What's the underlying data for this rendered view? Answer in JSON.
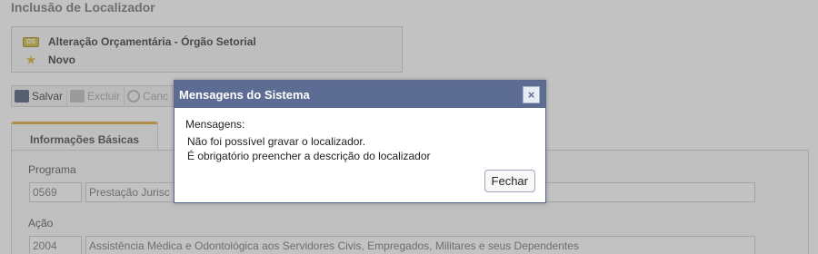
{
  "page": {
    "title": "Inclusão de Localizador"
  },
  "header_box": {
    "badge_label": "OS",
    "org_name": "Alteração Orçamentária - Órgão Setorial",
    "status": "Novo"
  },
  "toolbar": {
    "save_label": "Salvar",
    "delete_label": "Excluir",
    "cancel_label": "Canc"
  },
  "tabs": {
    "active_label": "Informações Básicas"
  },
  "form": {
    "programa_label": "Programa",
    "programa_code": "0569",
    "programa_desc": "Prestação Jurisc",
    "acao_label": "Ação",
    "acao_code": "2004",
    "acao_desc": "Assistência Médica e Odontológica aos Servidores Civis, Empregados, Militares e seus Dependentes"
  },
  "dialog": {
    "title": "Mensagens do Sistema",
    "close_glyph": "×",
    "heading": "Mensagens:",
    "messages": [
      "Não foi possível gravar o localizador.",
      "É obrigatório preencher a descrição do localizador"
    ],
    "button_label": "Fechar"
  }
}
